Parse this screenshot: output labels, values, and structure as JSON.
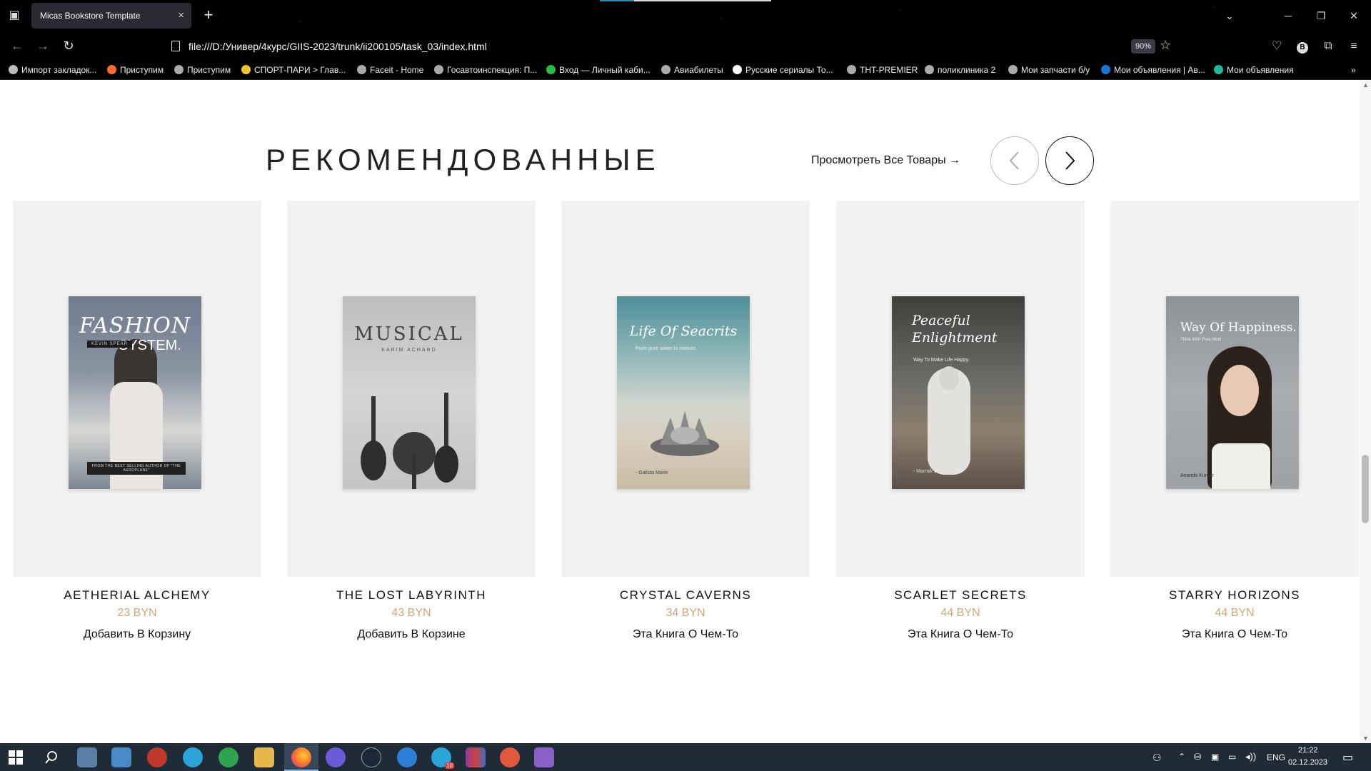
{
  "browser": {
    "tab_title": "Micas Bookstore Template",
    "tab_close_glyph": "×",
    "new_tab_glyph": "+",
    "url": "file:///D:/Универ/4курс/GIIS-2023/trunk/ii200105/task_03/index.html",
    "zoom": "90%",
    "bookmarks": [
      {
        "label": "Импорт закладок...",
        "color": "#bbbbbb"
      },
      {
        "label": "Приступим",
        "color": "#ff6a2a"
      },
      {
        "label": "Приступим",
        "color": "#aaaaaa"
      },
      {
        "label": "СПОРТ-ПАРИ > Глав...",
        "color": "#f2c52e"
      },
      {
        "label": "Faceit - Home",
        "color": "#aaaaaa"
      },
      {
        "label": "Госавтоинспекция: П...",
        "color": "#aaaaaa"
      },
      {
        "label": "Вход — Личный каби...",
        "color": "#2dbb4a"
      },
      {
        "label": "Авиабилеты",
        "color": "#aaaaaa"
      },
      {
        "label": "Русские сериалы  То...",
        "color": "#ffffff"
      },
      {
        "label": "THT-PREMIER",
        "color": "#aaaaaa"
      },
      {
        "label": "поликлиника 2",
        "color": "#aaaaaa"
      },
      {
        "label": "Мои запчасти б/у",
        "color": "#aaaaaa"
      },
      {
        "label": "Мои объявления | Ав...",
        "color": "#1976d2"
      },
      {
        "label": "Мои объявления",
        "color": "#1fb89a"
      }
    ]
  },
  "section": {
    "title": "РЕКОМЕНДОВАННЫЕ",
    "view_all": "Просмотреть Все Товары →"
  },
  "products": [
    {
      "name": "AETHERIAL ALCHEMY",
      "price": "23 BYN",
      "action": "Добавить В Корзину",
      "cover": {
        "title": "FASHION",
        "title2": "SYSTEM.",
        "author": "KEVIN SPEAR",
        "tagline": "FROM THE BEST SELLING AUTHOR OF \"THE AEROPLANE\"",
        "bg": "#7f8a9a"
      }
    },
    {
      "name": "THE LOST LABYRINTH",
      "price": "43 BYN",
      "action": "Добавить В Корзине",
      "cover": {
        "title": "MUSICAL",
        "author": "KARIM ACHARD",
        "bg": "#c8c8c8"
      }
    },
    {
      "name": "CRYSTAL CAVERNS",
      "price": "34 BYN",
      "action": "Эта Книга О Чем-То",
      "cover": {
        "title": "Life Of Seacrits",
        "subtitle": "From pure water to mixture.",
        "author": "- Galista Marie",
        "bg": "#9fbcc0"
      }
    },
    {
      "name": "SCARLET SECRETS",
      "price": "44 BYN",
      "action": "Эта Книга О Чем-То",
      "cover": {
        "title": "Peaceful Enlightment",
        "subtitle": "Way To Make Life Happy.",
        "author": "- Marmik Lama",
        "bg": "#6a6a66"
      }
    },
    {
      "name": "STARRY HORIZONS",
      "price": "44 BYN",
      "action": "Эта Книга О Чем-То",
      "cover": {
        "title": "Way Of Happiness.",
        "subtitle": "Think With Pure Mind",
        "author": "Ananda Kumar",
        "bg": "#9da2a6"
      }
    }
  ],
  "taskbar": {
    "language": "ENG",
    "time": "21:22",
    "date": "02.12.2023",
    "telegram_badge": "10"
  }
}
